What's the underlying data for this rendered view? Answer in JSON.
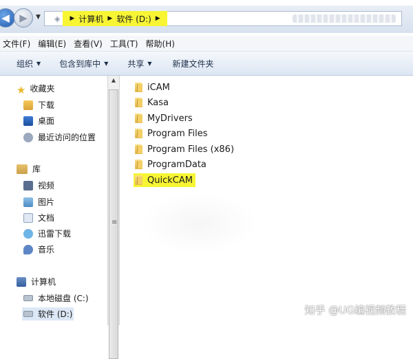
{
  "address": {
    "crumbs": [
      "计算机",
      "软件 (D:)"
    ]
  },
  "menu": [
    "文件(F)",
    "编辑(E)",
    "查看(V)",
    "工具(T)",
    "帮助(H)"
  ],
  "toolbar": {
    "organize": "组织",
    "include_library": "包含到库中",
    "share": "共享",
    "new_folder": "新建文件夹"
  },
  "nav": {
    "favorites": "收藏夹",
    "downloads": "下载",
    "desktop": "桌面",
    "recent": "最近访问的位置",
    "libraries": "库",
    "videos": "视频",
    "pictures": "图片",
    "documents": "文档",
    "thunder": "迅雷下载",
    "music": "音乐",
    "computer": "计算机",
    "drive_c": "本地磁盘 (C:)",
    "drive_d": "软件 (D:)"
  },
  "files": [
    "iCAM",
    "Kasa",
    "MyDrivers",
    "Program Files",
    "Program Files (x86)",
    "ProgramData",
    "QuickCAM"
  ],
  "watermark": "知乎 @UG编视频教程",
  "colors": {
    "highlight": "#f7f534",
    "selection": "#dce8f5"
  }
}
